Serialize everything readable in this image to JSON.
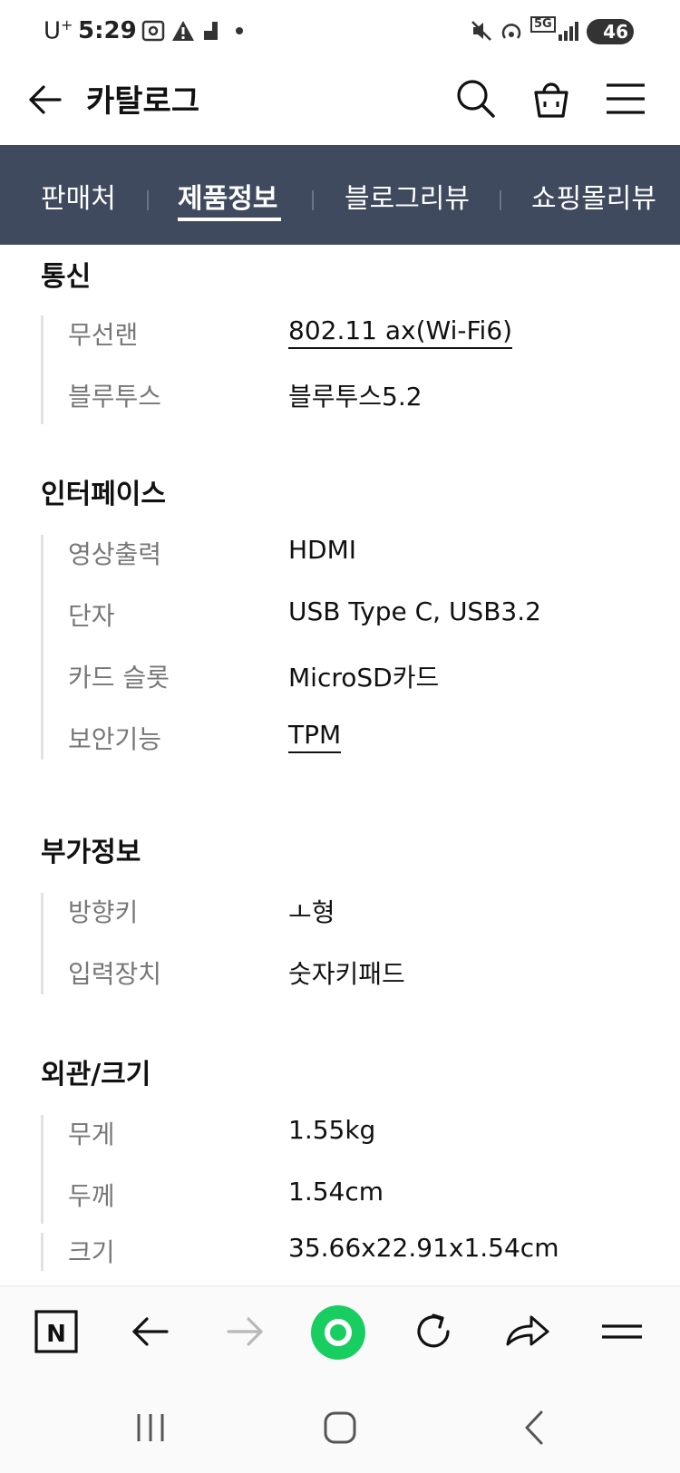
{
  "status_bar": {
    "carrier": "U",
    "carrier_sup": "+",
    "time": "5:29",
    "battery": "46",
    "network": "5G"
  },
  "header": {
    "title": "카탈로그",
    "icons": [
      "back-arrow-icon",
      "search-icon",
      "shopping-bag-icon",
      "menu-icon"
    ]
  },
  "tabs": [
    {
      "label": "판매처"
    },
    {
      "label": "제품정보",
      "active": true
    },
    {
      "label": "블로그리뷰"
    },
    {
      "label": "쇼핑몰리뷰"
    }
  ],
  "sections": [
    {
      "title": "통신",
      "rows": [
        {
          "label": "무선랜",
          "value": "802.11 ax(Wi-Fi6)",
          "link": true
        },
        {
          "label": "블루투스",
          "value": "블루투스5.2",
          "link": false
        }
      ]
    },
    {
      "title": "인터페이스",
      "rows": [
        {
          "label": "영상출력",
          "value": "HDMI",
          "link": false
        },
        {
          "label": "단자",
          "value": "USB Type C, USB3.2",
          "link": false
        },
        {
          "label": "카드 슬롯",
          "value": "MicroSD카드",
          "link": false
        },
        {
          "label": "보안기능",
          "value": "TPM",
          "link": true
        }
      ]
    },
    {
      "title": "부가정보",
      "rows": [
        {
          "label": "방향키",
          "value": "ㅗ형",
          "link": false
        },
        {
          "label": "입력장치",
          "value": "숫자키패드",
          "link": false
        }
      ]
    },
    {
      "title": "외관/크기",
      "rows": [
        {
          "label": "무게",
          "value": "1.55kg",
          "link": false
        },
        {
          "label": "두께",
          "value": "1.54cm",
          "link": false
        },
        {
          "label": "크기",
          "value": "35.66x22.91x1.54cm",
          "link": false
        }
      ]
    }
  ],
  "browser_bar": {
    "icons": [
      "naver-n-icon",
      "back-arrow-icon",
      "forward-arrow-icon",
      "green-circle-icon",
      "refresh-icon",
      "share-icon",
      "menu-icon"
    ],
    "n_letter": "N",
    "accent": "#19ce60"
  },
  "nav_bar": {
    "icons": [
      "recent-apps-icon",
      "home-icon",
      "back-icon"
    ]
  }
}
